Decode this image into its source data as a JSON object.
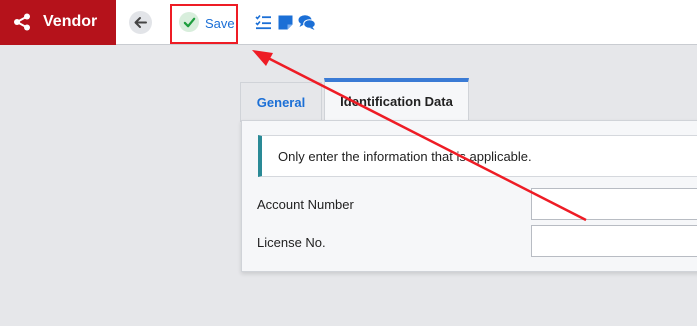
{
  "app": {
    "title": "Vendor",
    "brand_color": "#b5121b"
  },
  "toolbar": {
    "save_label": "Save",
    "accent_color": "#1b6fd6"
  },
  "tabs": [
    {
      "label": "General",
      "active": false
    },
    {
      "label": "Identification Data",
      "active": true
    }
  ],
  "notice": {
    "text": "Only enter the information that is applicable."
  },
  "fields": [
    {
      "label": "Account Number",
      "value": ""
    },
    {
      "label": "License No.",
      "value": ""
    }
  ],
  "icons": [
    "share-icon",
    "back-arrow-icon",
    "check-icon",
    "checklist-icon",
    "note-icon",
    "comments-icon"
  ]
}
